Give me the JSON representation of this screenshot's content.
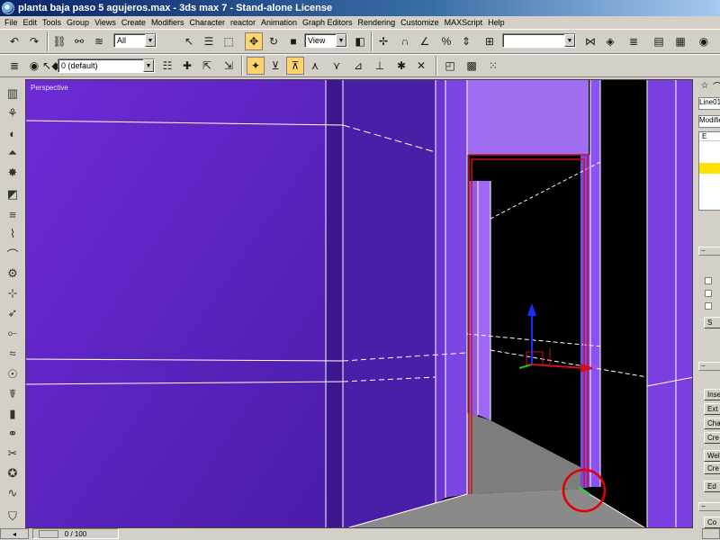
{
  "window": {
    "title": "planta baja paso 5 agujeros.max - 3ds max 7 - Stand-alone License"
  },
  "menu": {
    "items": [
      "File",
      "Edit",
      "Tools",
      "Group",
      "Views",
      "Create",
      "Modifiers",
      "Character",
      "reactor",
      "Animation",
      "Graph Editors",
      "Rendering",
      "Customize",
      "MAXScript",
      "Help"
    ]
  },
  "toolbar": {
    "selection_filter": "All",
    "reference_coord": "View",
    "named_selection": "",
    "layer": "0 (default)"
  },
  "viewport": {
    "label": "Perspective",
    "background_color": "#6e2bd6",
    "highlight_color": "#cc1020"
  },
  "command_panel": {
    "object_name": "Line01",
    "modifier_list": "Modifier List",
    "stack_top_item": "E",
    "buttons": [
      "S",
      "Inse",
      "Ext",
      "Cha",
      "Cre",
      "Wel",
      "Cre",
      "Ed",
      "Co"
    ]
  },
  "status": {
    "time_slider": "0 / 100"
  },
  "icons": {
    "undo": "undo-icon",
    "redo": "redo-icon",
    "select_link": "select-link-icon",
    "unlink": "unlink-icon",
    "bind_space_warp": "bind-space-warp-icon",
    "select_object": "select-object-icon",
    "select_by_name": "select-by-name-icon",
    "rect_region": "rectangular-selection-icon",
    "window_crossing": "window-crossing-icon",
    "move": "move-icon",
    "rotate": "rotate-icon",
    "scale": "scale-icon",
    "pivot": "pivot-center-icon",
    "manipulate": "manipulate-icon",
    "snap": "snap-icon",
    "angle_snap": "angle-snap-icon",
    "percent_snap": "percent-snap-icon",
    "spinner_snap": "spinner-snap-icon",
    "named_sets": "named-selection-sets-icon",
    "mirror": "mirror-icon",
    "align": "align-icon",
    "layers": "layer-manager-icon",
    "curve_editor": "curve-editor-icon",
    "schematic": "schematic-view-icon",
    "material_editor": "material-editor-icon"
  }
}
